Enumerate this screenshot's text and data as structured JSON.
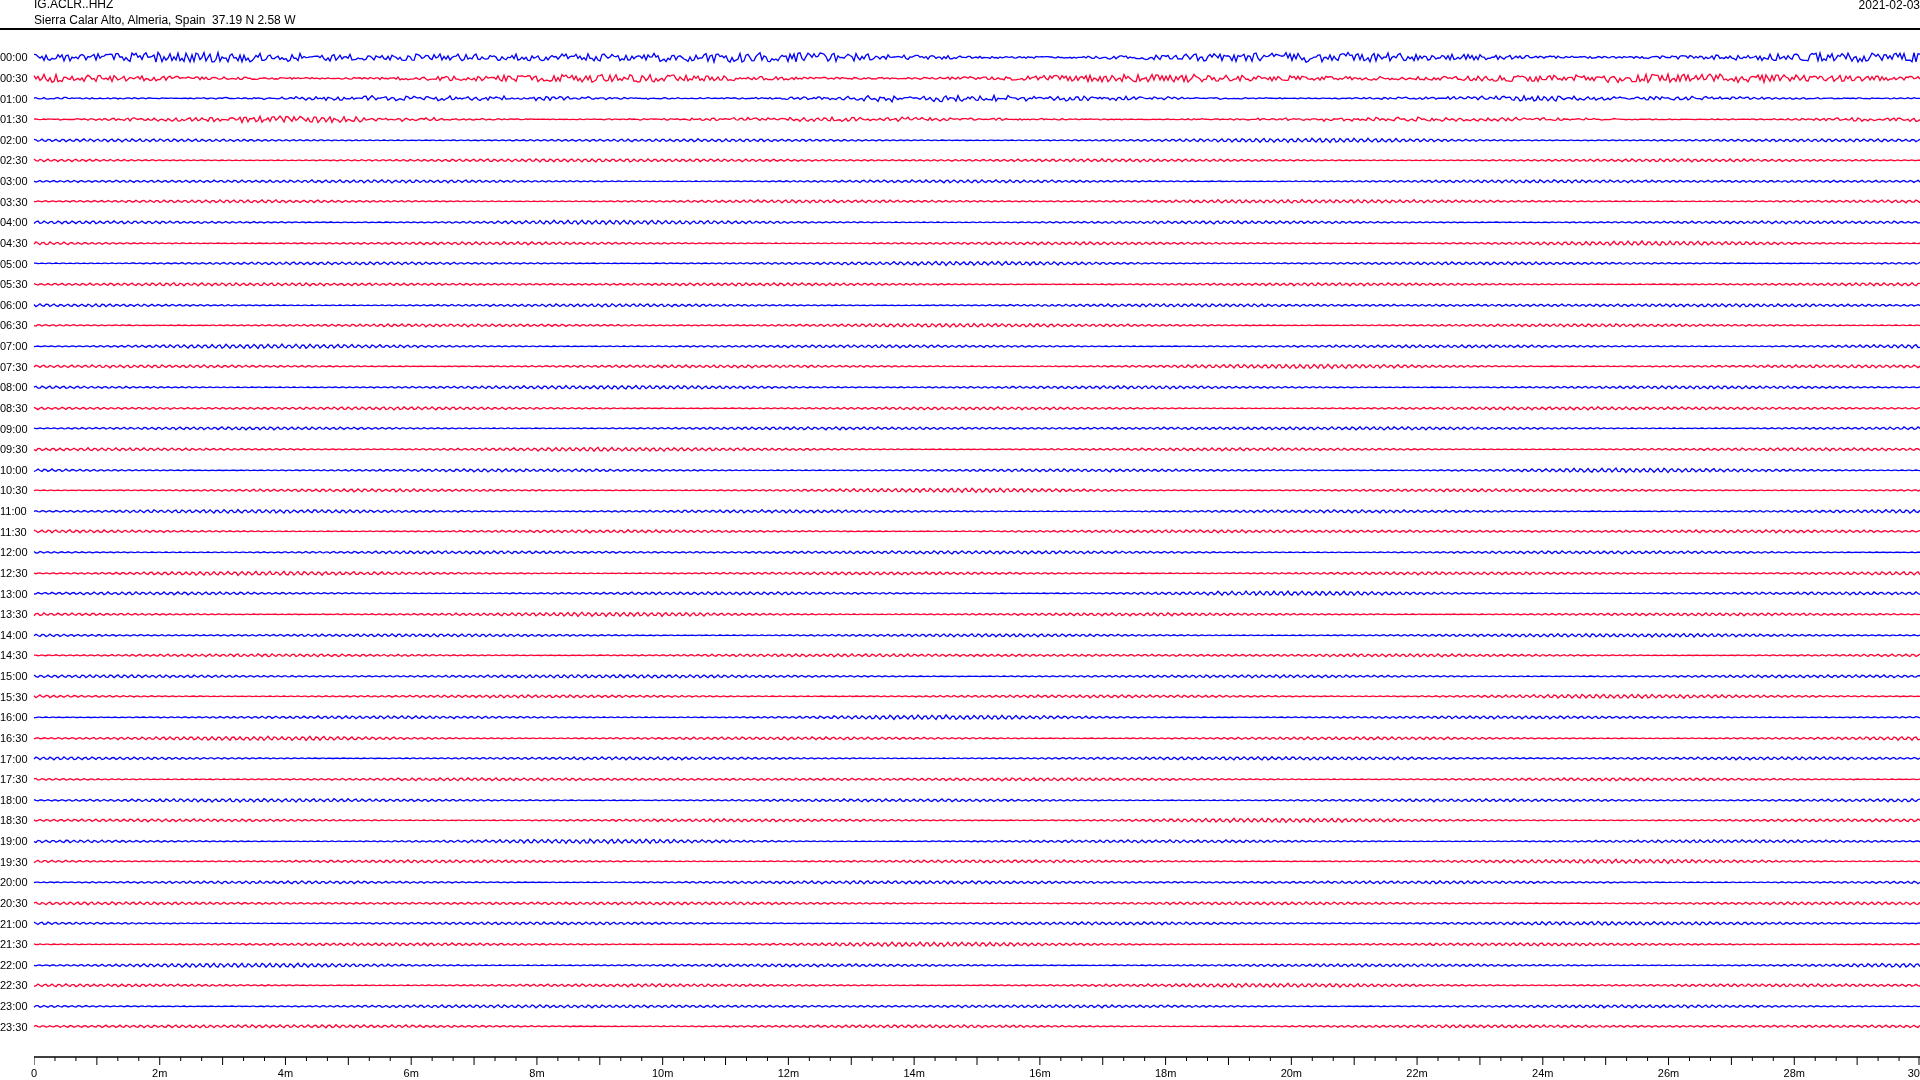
{
  "header": {
    "station": "IG.ACLR..HHZ",
    "location": "Sierra Calar Alto, Almeria, Spain  37.19 N 2.58 W",
    "date": "2021-02-03"
  },
  "traces": [
    {
      "label": "00:00",
      "color": "#0000ff"
    },
    {
      "label": "00:30",
      "color": "#ff0033"
    },
    {
      "label": "01:00",
      "color": "#0000ff"
    },
    {
      "label": "01:30",
      "color": "#ff0033"
    },
    {
      "label": "02:00",
      "color": "#0000ff"
    },
    {
      "label": "02:30",
      "color": "#ff0033"
    },
    {
      "label": "03:00",
      "color": "#0000ff"
    },
    {
      "label": "03:30",
      "color": "#ff0033"
    },
    {
      "label": "04:00",
      "color": "#0000ff"
    },
    {
      "label": "04:30",
      "color": "#ff0033"
    },
    {
      "label": "05:00",
      "color": "#0000ff"
    },
    {
      "label": "05:30",
      "color": "#ff0033"
    },
    {
      "label": "06:00",
      "color": "#0000ff"
    },
    {
      "label": "06:30",
      "color": "#ff0033"
    },
    {
      "label": "07:00",
      "color": "#0000ff"
    },
    {
      "label": "07:30",
      "color": "#ff0033"
    },
    {
      "label": "08:00",
      "color": "#0000ff"
    },
    {
      "label": "08:30",
      "color": "#ff0033"
    },
    {
      "label": "09:00",
      "color": "#0000ff"
    },
    {
      "label": "09:30",
      "color": "#ff0033"
    },
    {
      "label": "10:00",
      "color": "#0000ff"
    },
    {
      "label": "10:30",
      "color": "#ff0033"
    },
    {
      "label": "11:00",
      "color": "#0000ff"
    },
    {
      "label": "11:30",
      "color": "#ff0033"
    },
    {
      "label": "12:00",
      "color": "#0000ff"
    },
    {
      "label": "12:30",
      "color": "#ff0033"
    },
    {
      "label": "13:00",
      "color": "#0000ff"
    },
    {
      "label": "13:30",
      "color": "#ff0033"
    },
    {
      "label": "14:00",
      "color": "#0000ff"
    },
    {
      "label": "14:30",
      "color": "#ff0033"
    },
    {
      "label": "15:00",
      "color": "#0000ff"
    },
    {
      "label": "15:30",
      "color": "#ff0033"
    },
    {
      "label": "16:00",
      "color": "#0000ff"
    },
    {
      "label": "16:30",
      "color": "#ff0033"
    },
    {
      "label": "17:00",
      "color": "#0000ff"
    },
    {
      "label": "17:30",
      "color": "#ff0033"
    },
    {
      "label": "18:00",
      "color": "#0000ff"
    },
    {
      "label": "18:30",
      "color": "#ff0033"
    },
    {
      "label": "19:00",
      "color": "#0000ff"
    },
    {
      "label": "19:30",
      "color": "#ff0033"
    },
    {
      "label": "20:00",
      "color": "#0000ff"
    },
    {
      "label": "20:30",
      "color": "#ff0033"
    },
    {
      "label": "21:00",
      "color": "#0000ff"
    },
    {
      "label": "21:30",
      "color": "#ff0033"
    },
    {
      "label": "22:00",
      "color": "#0000ff"
    },
    {
      "label": "22:30",
      "color": "#ff0033"
    },
    {
      "label": "23:00",
      "color": "#0000ff"
    },
    {
      "label": "23:30",
      "color": "#ff0033"
    }
  ],
  "time_axis": {
    "labels": [
      "0",
      "2m",
      "4m",
      "6m",
      "8m",
      "10m",
      "12m",
      "14m",
      "16m",
      "18m",
      "20m",
      "22m",
      "24m",
      "26m",
      "28m",
      "30"
    ]
  }
}
